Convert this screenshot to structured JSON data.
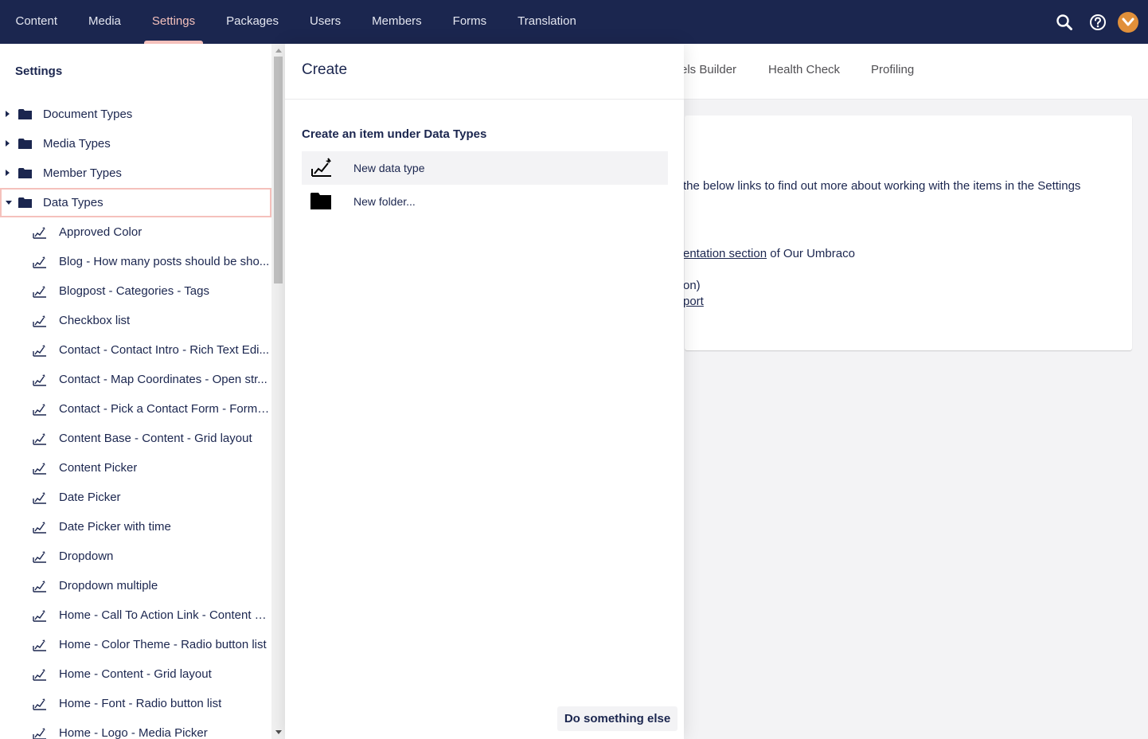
{
  "colors": {
    "topbar": "#1b264f",
    "active_nav": "#f5c1bc",
    "text": "#1b264f",
    "avatar": "#e1903a"
  },
  "topnav": {
    "items": [
      {
        "label": "Content"
      },
      {
        "label": "Media"
      },
      {
        "label": "Settings",
        "active": true
      },
      {
        "label": "Packages"
      },
      {
        "label": "Users"
      },
      {
        "label": "Members"
      },
      {
        "label": "Forms"
      },
      {
        "label": "Translation"
      }
    ],
    "icons": [
      "search-icon",
      "help-icon",
      "user-avatar"
    ]
  },
  "sidebar": {
    "title": "Settings",
    "roots": [
      {
        "label": "Document Types",
        "expanded": false
      },
      {
        "label": "Media Types",
        "expanded": false
      },
      {
        "label": "Member Types",
        "expanded": false
      },
      {
        "label": "Data Types",
        "expanded": true,
        "selected": true
      }
    ],
    "data_types": [
      "Approved Color",
      "Blog - How many posts should be sho...",
      "Blogpost - Categories - Tags",
      "Checkbox list",
      "Contact - Contact Intro - Rich Text Edi...",
      "Contact - Map Coordinates - Open str...",
      "Contact - Pick a Contact Form - Form ...",
      "Content Base - Content - Grid layout",
      "Content Picker",
      "Date Picker",
      "Date Picker with time",
      "Dropdown",
      "Dropdown multiple",
      "Home - Call To Action Link - Content P...",
      "Home - Color Theme - Radio button list",
      "Home - Content - Grid layout",
      "Home - Font - Radio button list",
      "Home - Logo - Media Picker"
    ]
  },
  "dashboard": {
    "tabs": [
      "els Builder",
      "Health Check",
      "Profiling"
    ],
    "line1": "the below links to find out more about working with the items in the Settings",
    "link1": "entation section",
    "line2_rest": " of Our Umbraco",
    "line3": "on)",
    "link2": "port"
  },
  "create_dialog": {
    "title": "Create",
    "subtitle": "Create an item under Data Types",
    "items": [
      {
        "label": "New data type",
        "icon": "data-type-icon"
      },
      {
        "label": "New folder...",
        "icon": "folder-icon"
      }
    ],
    "secondary_button": "Do something else"
  }
}
